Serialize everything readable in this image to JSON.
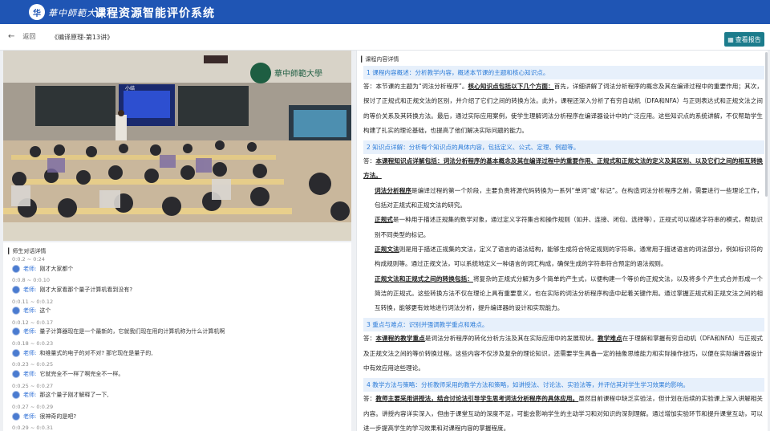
{
  "header": {
    "logo_text": "华",
    "university": "華中師範大學",
    "app_title": "课程资源智能评价系统"
  },
  "toolbar": {
    "back_label": "返回",
    "course_title": "《编译原理-第13讲》",
    "report_label": "查看报告"
  },
  "video": {
    "slide_title": "小结",
    "watermark": "華中師範大學"
  },
  "dialogue": {
    "title": "师生对话详情",
    "items": [
      {
        "time": "0:0.2 ~ 0:24",
        "speaker": "老师:",
        "text": "刚才大家都个"
      },
      {
        "time": "0:0.8 ~ 0:0.10",
        "speaker": "老师:",
        "text": "刚才大家看那个量子计算机看到没有?"
      },
      {
        "time": "0:0.11 ~ 0:0.12",
        "speaker": "老师:",
        "text": "这个"
      },
      {
        "time": "0:0.12 ~ 0:0.17",
        "speaker": "老师:",
        "text": "量子计算器现在是一个最新的，它就我们现在用的计算机称为什么计算机啊"
      },
      {
        "time": "0:0.18 ~ 0:0.23",
        "speaker": "老师:",
        "text": "和维量式的电子的对不对? 那它现在是量子的,"
      },
      {
        "time": "0:0.23 ~ 0:0.25",
        "speaker": "老师:",
        "text": "它就完全不一样了啊完全不一样。"
      },
      {
        "time": "0:0.25 ~ 0:0.27",
        "speaker": "老师:",
        "text": "那这个量子刚才解释了一下,"
      },
      {
        "time": "0:0.27 ~ 0:0.29",
        "speaker": "老师:",
        "text": "很神奇的是吧?"
      },
      {
        "time": "0:0.29 ~ 0:0.31",
        "speaker": "",
        "text": ""
      }
    ]
  },
  "details": {
    "title": "课程内容详情",
    "s1_title": "1  课程内容概述：分析教学内容，概述本节课的主题和核心知识点。",
    "s1_a": "答：本节课的主题为“词法分析程序”。",
    "s1_a_ul": "核心知识点包括以下几个方面：",
    "s1_a_rest": "首先，详细讲解了词法分析程序的概念及其在编译过程中的重要作用；其次，探讨了正规式和正规文法的区别，并介绍了它们之间的转换方法。此外，课程还深入分析了有穷自动机（DFA和NFA）与正则表达式和正规文法之间的等价关系及其转换方法。最后，通过实际应用案例，使学生理解词法分析程序在编译器设计中的广泛应用。这些知识点的系统讲解，不仅帮助学生构建了扎实的理论基础，也提高了他们解决实际问题的能力。",
    "s2_title": "2  知识点详解：分析每个知识点的具体内容，包括定义、公式、定理、例题等。",
    "s2_a": "答：",
    "s2_a_ul": "本课程知识点详解包括：词法分析程序的基本概念及其在编译过程中的重要作用、正规式和正规文法的定义及其区别、以及它们之间的相互转换方法。",
    "s2_p1_ul": "词法分析程序",
    "s2_p1": "是编译过程的第一个阶段，主要负责将源代码转换为一系列“单词”或“标记”。在构造词法分析程序之前，需要进行一些理论工作，包括对正规式和正规文法的研究。",
    "s2_p2_ul": "正规式",
    "s2_p2": "是一种用于描述正规集的数学对象，通过定义字符集合和操作规则（如并、连接、闭包、选择等），正规式可以描述字符串的模式，帮助识别不同类型的标记。",
    "s2_p3_ul": "正规文法",
    "s2_p3": "则是用于描述正规集的文法，定义了语言的语法结构，能够生成符合特定规则的字符串。通常用于描述语言的词法部分，例如标识符的构成规则等。通过正规文法，可以系统地定义一种语言的词汇构成，确保生成的字符串符合预定的语法规则。",
    "s2_p4_ul": "正规文法和正规式之间的转换包括：",
    "s2_p4": "将复杂的正规式分解为多个简单的产生式，以便构建一个等价的正规文法，以及将多个产生式合并形成一个简洁的正规式。这些转换方法不仅在理论上具有重要意义，也在实际的词法分析程序构造中起着关键作用。通过掌握正规式和正规文法之间的相互转换，能够更有效地进行词法分析，提升编译器的设计和实现能力。",
    "s3_title": "3  重点与难点：识别并强调教学重点和难点。",
    "s3_a": "答：",
    "s3_a_ul1": "本课程的教学重点",
    "s3_a_1": "是词法分析程序的转化分析方法及其在实际应用中的发展现状。",
    "s3_a_ul2": "教学难点",
    "s3_a_2": "在于理解和掌握有穷自动机（DFA和NFA）与正规式及正规文法之间的等价转换过程。这些内容不仅涉及复杂的理论知识，还需要学生具备一定的抽象思维能力和实际操作技巧，以便在实际编译器设计中有效应用这些理论。",
    "s4_title": "4  教学方法与策略：分析教师采用的教学方法和策略，如讲授法、讨论法、实验法等，并评估其对学生学习效果的影响。",
    "s4_a": "答：",
    "s4_a_ul": "教师主要采用讲授法，结合讨论法引导学生思考词法分析程序的具体应用。",
    "s4_a_rest": "虽然目前课程中缺乏实验法，但计划在后续的实验课上深入讲解相关内容。讲授内容详实深入，但由于课堂互动的深度不足，可能会影响学生的主动学习和对知识的深刻理解。通过增加实验环节和提升课堂互动，可以进一步提高学生的学习效果和对课程内容的掌握程度。"
  }
}
